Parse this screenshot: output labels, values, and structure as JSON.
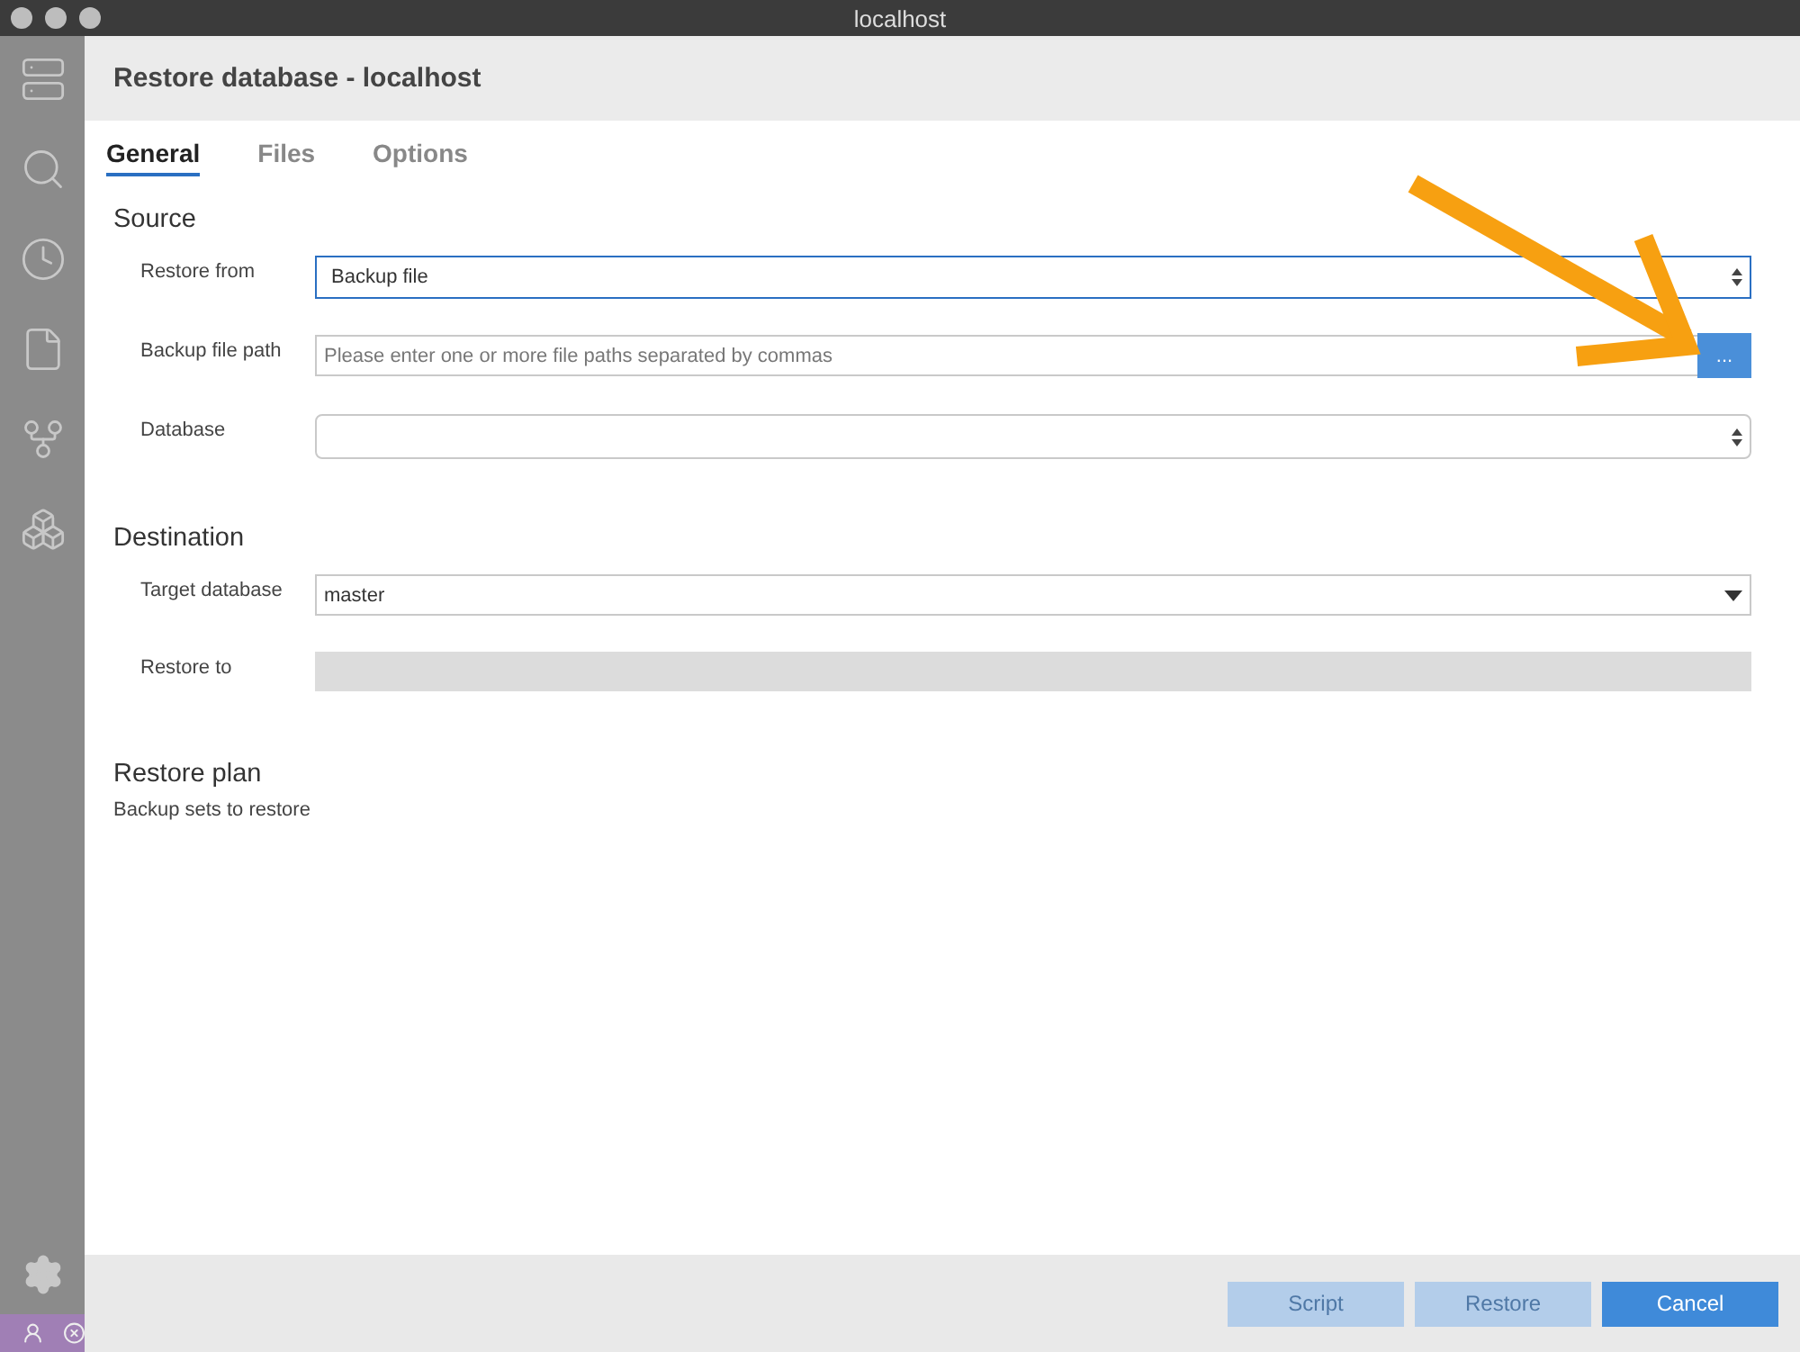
{
  "window": {
    "title": "localhost"
  },
  "sidebar": {
    "items": [
      {
        "selected": false
      },
      {
        "selected": false
      },
      {
        "selected": false
      },
      {
        "selected": false
      },
      {
        "selected": false
      },
      {
        "selected": false
      }
    ]
  },
  "dialog": {
    "title": "Restore database - localhost",
    "tabs": [
      {
        "label": "General",
        "selected": true
      },
      {
        "label": "Files",
        "selected": false
      },
      {
        "label": "Options",
        "selected": false
      }
    ],
    "sections": [
      {
        "title": "Source",
        "fields": [
          {
            "label": "Restore from",
            "kind": "stepper-select",
            "value": "Backup file",
            "focused": true
          },
          {
            "label": "Backup file path",
            "kind": "browse",
            "placeholder": "Please enter one or more file paths separated by commas",
            "button": "..."
          },
          {
            "label": "Database",
            "kind": "stepper-select",
            "focused": false
          }
        ]
      },
      {
        "title": "Destination",
        "fields": [
          {
            "label": "Target database",
            "kind": "dropdown",
            "value": "master"
          },
          {
            "label": "Restore to",
            "kind": "disabled"
          }
        ]
      },
      {
        "title": "Restore plan",
        "subtitle": "Backup sets to restore"
      }
    ],
    "buttons": [
      {
        "label": "Script",
        "disabled": true
      },
      {
        "label": "Restore",
        "disabled": true
      },
      {
        "label": "Cancel",
        "disabled": false
      }
    ]
  }
}
